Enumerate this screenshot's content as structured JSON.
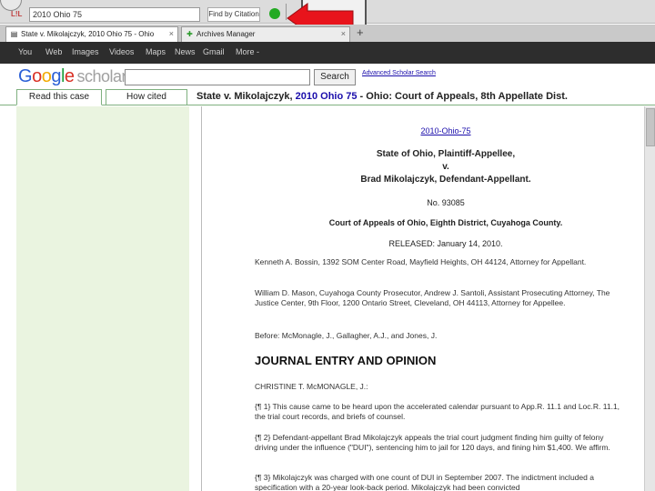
{
  "toolbar": {
    "ext_label": "L!L",
    "search_value": "2010 Ohio 75",
    "find_button": "Find by Citation"
  },
  "tabs": [
    {
      "label": "State v. Mikolajczyk, 2010 Ohio 75 - Ohio",
      "close": "×"
    },
    {
      "label": "Archives Manager",
      "close": "×"
    }
  ],
  "new_tab": "+",
  "gnav": {
    "items": [
      "You",
      "Web",
      "Images",
      "Videos",
      "Maps",
      "News",
      "Gmail",
      "More -"
    ]
  },
  "scholar": {
    "logo_letters": [
      "G",
      "o",
      "o",
      "g",
      "l",
      "e"
    ],
    "logo_suffix": "scholar",
    "search_button": "Search",
    "advanced_link": "Advanced Scholar Search"
  },
  "case_tabs": {
    "read": "Read this case",
    "cited": "How cited"
  },
  "case_title": {
    "prefix": "State v. Mikolajczyk, ",
    "citation": "2010 Ohio 75",
    "suffix": " - Ohio: Court of Appeals, 8th Appellate Dist."
  },
  "document": {
    "cite": "2010-Ohio-75",
    "parties_line1": "State of Ohio, Plaintiff-Appellee,",
    "parties_line2": "v.",
    "parties_line3": "Brad Mikolajczyk, Defendant-Appellant.",
    "docket": "No. 93085",
    "court": "Court of Appeals of Ohio, Eighth District, Cuyahoga County.",
    "released": "RELEASED: January 14, 2010.",
    "counsel_appellant": "Kenneth A. Bossin, 1392 SOM Center Road, Mayfield Heights, OH 44124, Attorney for Appellant.",
    "counsel_appellee": "William D. Mason, Cuyahoga County Prosecutor, Andrew J. Santoli, Assistant Prosecuting Attorney, The Justice Center, 9th Floor, 1200 Ontario Street, Cleveland, OH 44113, Attorney for Appellee.",
    "before": "Before: McMonagle, J., Gallagher, A.J., and Jones, J.",
    "heading": "JOURNAL ENTRY AND OPINION",
    "author": "CHRISTINE T. McMONAGLE, J.:",
    "p1": "{¶ 1} This cause came to be heard upon the accelerated calendar pursuant to App.R. 11.1 and Loc.R. 11.1, the trial court records, and briefs of counsel.",
    "p2": "{¶ 2} Defendant-appellant Brad Mikolajczyk appeals the trial court judgment finding him guilty of felony driving under the influence (\"DUI\"), sentencing him to jail for 120 days, and fining him $1,400. We affirm.",
    "p3": "{¶ 3} Mikolajczyk was charged with one count of DUI in September 2007. The indictment included a specification with a 20-year look-back period. Mikolajczyk had been convicted"
  },
  "colors": {
    "left_panel": "#eaf4e0",
    "link": "#1a0dab",
    "arrow": "#e8141c",
    "status_green": "#22aa22"
  }
}
